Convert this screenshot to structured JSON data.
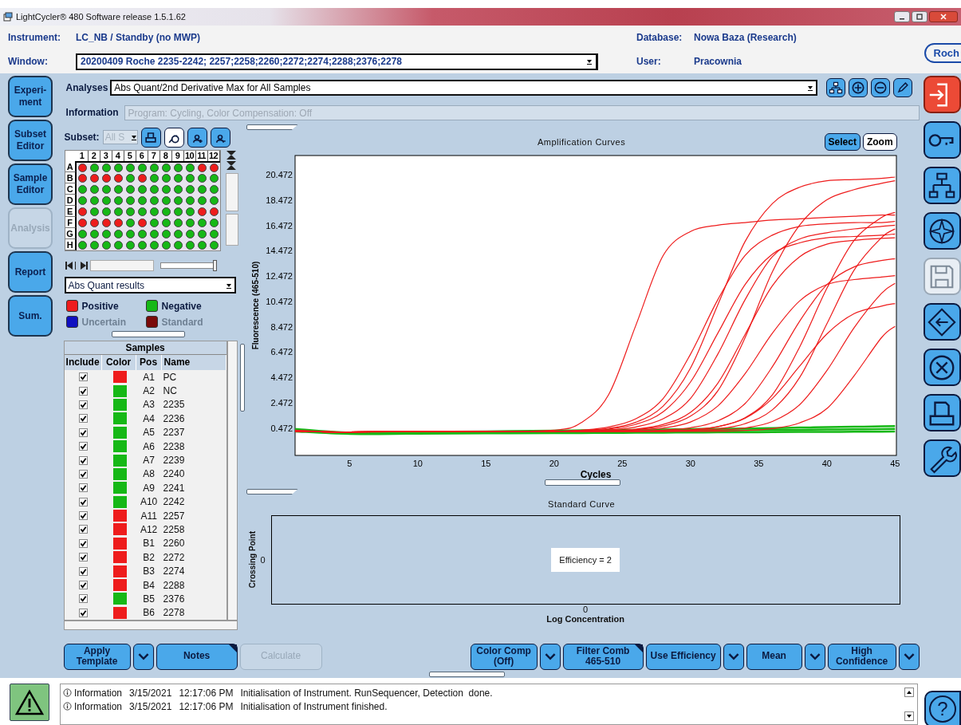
{
  "window": {
    "title": "LightCycler® 480 Software release 1.5.1.62"
  },
  "header": {
    "instrument_label": "Instrument:",
    "instrument": "LC_NB / Standby (no MWP)",
    "database_label": "Database:",
    "database": "Nowa Baza (Research)",
    "window_label": "Window:",
    "window_value": "20200409 Roche 2235-2242; 2257;2258;2260;2272;2274;2288;2376;2278",
    "user_label": "User:",
    "user": "Pracownia",
    "logo": "Roch"
  },
  "nav": [
    {
      "label": "Experi-\nment",
      "disabled": false
    },
    {
      "label": "Subset\nEditor",
      "disabled": false
    },
    {
      "label": "Sample\nEditor",
      "disabled": false
    },
    {
      "label": "Analysis",
      "disabled": true
    },
    {
      "label": "Report",
      "disabled": false
    },
    {
      "label": "Sum.",
      "disabled": false
    }
  ],
  "analyses": {
    "label": "Analyses",
    "value": "Abs Quant/2nd Derivative Max for All Samples",
    "information": {
      "label": "Information",
      "value": "Program: Cycling, Color Compensation: Off",
      "disabled": true
    }
  },
  "subset": {
    "label": "Subset:",
    "value": "All S",
    "disabled": true
  },
  "plate": {
    "columns": [
      "1",
      "2",
      "3",
      "4",
      "5",
      "6",
      "7",
      "8",
      "9",
      "10",
      "11",
      "12"
    ],
    "rows": [
      {
        "label": "A",
        "wells": [
          {
            "color": "#ee1c1c"
          },
          {
            "color": "#16b816"
          },
          {
            "color": "#16b816"
          },
          {
            "color": "#16b816"
          },
          {
            "color": "#16b816"
          },
          {
            "color": "#16b816"
          },
          {
            "color": "#16b816"
          },
          {
            "color": "#16b816"
          },
          {
            "color": "#16b816"
          },
          {
            "color": "#16b816"
          },
          {
            "color": "#ee1c1c"
          },
          {
            "color": "#ee1c1c"
          }
        ]
      },
      {
        "label": "B",
        "wells": [
          {
            "color": "#ee1c1c"
          },
          {
            "color": "#ee1c1c"
          },
          {
            "color": "#ee1c1c"
          },
          {
            "color": "#ee1c1c"
          },
          {
            "color": "#16b816"
          },
          {
            "color": "#ee1c1c"
          },
          {
            "color": "#16b816"
          },
          {
            "color": "#16b816"
          },
          {
            "color": "#16b816"
          },
          {
            "color": "#16b816"
          },
          {
            "color": "#16b816"
          },
          {
            "color": "#16b816"
          }
        ]
      },
      {
        "label": "C",
        "wells": [
          {
            "color": "#16b816"
          },
          {
            "color": "#16b816"
          },
          {
            "color": "#16b816"
          },
          {
            "color": "#16b816"
          },
          {
            "color": "#16b816"
          },
          {
            "color": "#16b816"
          },
          {
            "color": "#16b816"
          },
          {
            "color": "#16b816"
          },
          {
            "color": "#16b816"
          },
          {
            "color": "#16b816"
          },
          {
            "color": "#16b816"
          },
          {
            "color": "#16b816"
          }
        ]
      },
      {
        "label": "D",
        "wells": [
          {
            "color": "#16b816"
          },
          {
            "color": "#16b816"
          },
          {
            "color": "#16b816"
          },
          {
            "color": "#16b816"
          },
          {
            "color": "#16b816"
          },
          {
            "color": "#16b816"
          },
          {
            "color": "#16b816"
          },
          {
            "color": "#16b816"
          },
          {
            "color": "#16b816"
          },
          {
            "color": "#16b816"
          },
          {
            "color": "#16b816"
          },
          {
            "color": "#16b816"
          }
        ]
      },
      {
        "label": "E",
        "wells": [
          {
            "color": "#ee1c1c"
          },
          {
            "color": "#16b816"
          },
          {
            "color": "#16b816"
          },
          {
            "color": "#16b816"
          },
          {
            "color": "#16b816"
          },
          {
            "color": "#16b816"
          },
          {
            "color": "#16b816"
          },
          {
            "color": "#16b816"
          },
          {
            "color": "#16b816"
          },
          {
            "color": "#16b816"
          },
          {
            "color": "#ee1c1c"
          },
          {
            "color": "#ee1c1c"
          }
        ]
      },
      {
        "label": "F",
        "wells": [
          {
            "color": "#ee1c1c"
          },
          {
            "color": "#ee1c1c"
          },
          {
            "color": "#ee1c1c"
          },
          {
            "color": "#ee1c1c"
          },
          {
            "color": "#16b816"
          },
          {
            "color": "#ee1c1c"
          },
          {
            "color": "#16b816"
          },
          {
            "color": "#16b816"
          },
          {
            "color": "#16b816"
          },
          {
            "color": "#16b816"
          },
          {
            "color": "#16b816"
          },
          {
            "color": "#16b816"
          }
        ]
      },
      {
        "label": "G",
        "wells": [
          {
            "color": "#16b816"
          },
          {
            "color": "#16b816"
          },
          {
            "color": "#16b816"
          },
          {
            "color": "#16b816"
          },
          {
            "color": "#16b816"
          },
          {
            "color": "#16b816"
          },
          {
            "color": "#16b816"
          },
          {
            "color": "#16b816"
          },
          {
            "color": "#16b816"
          },
          {
            "color": "#16b816"
          },
          {
            "color": "#16b816"
          },
          {
            "color": "#16b816"
          }
        ]
      },
      {
        "label": "H",
        "wells": [
          {
            "color": "#16b816"
          },
          {
            "color": "#16b816"
          },
          {
            "color": "#16b816"
          },
          {
            "color": "#16b816"
          },
          {
            "color": "#16b816"
          },
          {
            "color": "#16b816"
          },
          {
            "color": "#16b816"
          },
          {
            "color": "#16b816"
          },
          {
            "color": "#16b816"
          },
          {
            "color": "#16b816"
          },
          {
            "color": "#16b816"
          },
          {
            "color": "#16b816"
          }
        ]
      }
    ]
  },
  "zoom_slider": {
    "level": 1
  },
  "report_select": "Abs Quant results",
  "legend": [
    {
      "label": "Positive",
      "color": "#ee1c1c",
      "disabled": false
    },
    {
      "label": "Negative",
      "color": "#16b816",
      "disabled": false
    },
    {
      "label": "Uncertain",
      "color": "#1010c0",
      "disabled": true
    },
    {
      "label": "Standard",
      "color": "#7a0a0a",
      "disabled": true
    }
  ],
  "samples": {
    "title": "Samples",
    "columns": [
      "Include",
      "Color",
      "Pos",
      "Name"
    ],
    "rows": [
      {
        "checked": true,
        "color": "#ee1c1c",
        "pos": "A1",
        "name": "PC"
      },
      {
        "checked": true,
        "color": "#16b816",
        "pos": "A2",
        "name": "NC"
      },
      {
        "checked": true,
        "color": "#16b816",
        "pos": "A3",
        "name": "2235"
      },
      {
        "checked": true,
        "color": "#16b816",
        "pos": "A4",
        "name": "2236"
      },
      {
        "checked": true,
        "color": "#16b816",
        "pos": "A5",
        "name": "2237"
      },
      {
        "checked": true,
        "color": "#16b816",
        "pos": "A6",
        "name": "2238"
      },
      {
        "checked": true,
        "color": "#16b816",
        "pos": "A7",
        "name": "2239"
      },
      {
        "checked": true,
        "color": "#16b816",
        "pos": "A8",
        "name": "2240"
      },
      {
        "checked": true,
        "color": "#16b816",
        "pos": "A9",
        "name": "2241"
      },
      {
        "checked": true,
        "color": "#16b816",
        "pos": "A10",
        "name": "2242"
      },
      {
        "checked": true,
        "color": "#ee1c1c",
        "pos": "A11",
        "name": "2257"
      },
      {
        "checked": true,
        "color": "#ee1c1c",
        "pos": "A12",
        "name": "2258"
      },
      {
        "checked": true,
        "color": "#ee1c1c",
        "pos": "B1",
        "name": "2260"
      },
      {
        "checked": true,
        "color": "#ee1c1c",
        "pos": "B2",
        "name": "2272"
      },
      {
        "checked": true,
        "color": "#ee1c1c",
        "pos": "B3",
        "name": "2274"
      },
      {
        "checked": true,
        "color": "#ee1c1c",
        "pos": "B4",
        "name": "2288"
      },
      {
        "checked": true,
        "color": "#16b816",
        "pos": "B5",
        "name": "2376"
      },
      {
        "checked": true,
        "color": "#ee1c1c",
        "pos": "B6",
        "name": "2278"
      }
    ]
  },
  "amplification": {
    "tabs": [
      {
        "label": "Select",
        "selected": true
      },
      {
        "label": "Zoom",
        "selected": false
      }
    ],
    "chart_data": {
      "type": "line",
      "title": "Amplification Curves",
      "xlabel": "Cycles",
      "ylabel": "Fluorescence (465-510)",
      "x": [
        1,
        5,
        10,
        15,
        20,
        22,
        24,
        26,
        28,
        30,
        32,
        34,
        36,
        38,
        40,
        42,
        44,
        45
      ],
      "xlim": [
        1,
        45.1
      ],
      "ylim": [
        -1.7,
        22
      ],
      "xticks": [
        5,
        10,
        15,
        20,
        25,
        30,
        35,
        40,
        45
      ],
      "yticks": [
        0.472,
        2.472,
        4.472,
        6.472,
        8.472,
        10.472,
        12.472,
        14.472,
        16.472,
        18.472,
        20.472
      ],
      "series": [
        {
          "color": "#16b816",
          "values": [
            0.4,
            0.1,
            0.15,
            0.2,
            0.25,
            0.28,
            0.3,
            0.32,
            0.35,
            0.38,
            0.4,
            0.43,
            0.46,
            0.5,
            0.53,
            0.56,
            0.6,
            0.62
          ]
        },
        {
          "color": "#16b816",
          "values": [
            0.3,
            0.05,
            0.1,
            0.12,
            0.15,
            0.17,
            0.18,
            0.2,
            0.22,
            0.24,
            0.26,
            0.28,
            0.3,
            0.32,
            0.34,
            0.36,
            0.38,
            0.4
          ]
        },
        {
          "color": "#16b816",
          "values": [
            0.2,
            0.0,
            0.02,
            0.05,
            0.06,
            0.07,
            0.08,
            0.09,
            0.1,
            0.11,
            0.12,
            0.13,
            0.14,
            0.15,
            0.16,
            0.17,
            0.18,
            0.19
          ]
        },
        {
          "color": "#ee1c1c",
          "values": [
            0.3,
            0.15,
            0.2,
            0.2,
            0.3,
            0.9,
            3.1,
            8.6,
            14.1,
            16.0,
            16.5,
            16.7,
            16.9,
            17.0,
            17.1,
            17.2,
            17.3,
            17.3
          ]
        },
        {
          "color": "#ee1c1c",
          "values": [
            0.2,
            0.15,
            0.2,
            0.2,
            0.2,
            0.28,
            0.44,
            0.92,
            2.2,
            5.2,
            10.2,
            15.2,
            18.2,
            19.5,
            20.0,
            20.1,
            20.2,
            20.3
          ]
        },
        {
          "color": "#ee1c1c",
          "values": [
            0.2,
            0.15,
            0.2,
            0.2,
            0.2,
            0.2,
            0.25,
            0.34,
            0.62,
            1.4,
            3.4,
            7.6,
            12.8,
            16.5,
            18.5,
            19.3,
            19.8,
            20.0
          ]
        },
        {
          "color": "#ee1c1c",
          "values": [
            0.2,
            0.15,
            0.2,
            0.2,
            0.2,
            0.3,
            0.55,
            1.2,
            2.8,
            6.3,
            10.6,
            14.1,
            15.7,
            16.4,
            16.6,
            16.7,
            16.7,
            16.8
          ]
        },
        {
          "color": "#ee1c1c",
          "values": [
            0.2,
            0.15,
            0.2,
            0.2,
            0.2,
            0.26,
            0.39,
            0.76,
            1.75,
            4.1,
            7.95,
            11.8,
            14.2,
            15.1,
            15.5,
            15.6,
            15.7,
            15.8
          ]
        },
        {
          "color": "#ee1c1c",
          "values": [
            0.25,
            0.15,
            0.2,
            0.2,
            0.2,
            0.23,
            0.32,
            0.55,
            1.2,
            2.8,
            6.3,
            10.6,
            14.0,
            15.4,
            15.9,
            16.2,
            16.4,
            16.5
          ]
        },
        {
          "color": "#ee1c1c",
          "values": [
            0.2,
            0.15,
            0.2,
            0.2,
            0.2,
            0.2,
            0.26,
            0.38,
            0.75,
            1.7,
            4.0,
            7.85,
            11.7,
            14.0,
            15.0,
            15.3,
            15.45,
            15.5
          ]
        },
        {
          "color": "#ee1c1c",
          "values": [
            0.2,
            0.15,
            0.2,
            0.2,
            0.2,
            0.2,
            0.24,
            0.29,
            0.46,
            0.94,
            2.2,
            4.75,
            7.95,
            10.5,
            11.8,
            12.2,
            12.4,
            12.5
          ]
        },
        {
          "color": "#ee1c1c",
          "values": [
            0.2,
            0.15,
            0.2,
            0.2,
            0.2,
            0.2,
            0.2,
            0.23,
            0.3,
            0.49,
            1.03,
            2.4,
            5.3,
            8.9,
            11.8,
            13.2,
            13.7,
            13.85
          ]
        },
        {
          "color": "#ee1c1c",
          "values": [
            0.2,
            0.15,
            0.2,
            0.2,
            0.2,
            0.2,
            0.2,
            0.2,
            0.24,
            0.33,
            0.58,
            1.28,
            3.08,
            6.86,
            11.5,
            15.3,
            17.1,
            17.5
          ]
        },
        {
          "color": "#ee1c1c",
          "values": [
            0.2,
            0.15,
            0.2,
            0.2,
            0.2,
            0.2,
            0.2,
            0.2,
            0.2,
            0.27,
            0.4,
            0.81,
            1.9,
            4.45,
            8.7,
            12.95,
            15.5,
            16.2
          ]
        },
        {
          "color": "#ee1c1c",
          "values": [
            0.2,
            0.15,
            0.2,
            0.2,
            0.2,
            0.2,
            0.2,
            0.2,
            0.24,
            0.32,
            0.57,
            1.23,
            2.8,
            5.35,
            7.9,
            9.5,
            10.1,
            10.3
          ]
        },
        {
          "color": "#ee1c1c",
          "values": [
            0.2,
            0.15,
            0.2,
            0.2,
            0.2,
            0.2,
            0.2,
            0.2,
            0.2,
            0.23,
            0.29,
            0.47,
            0.98,
            2.3,
            5.0,
            8.4,
            11.1,
            11.9
          ]
        },
        {
          "color": "#ee1c1c",
          "values": [
            0.2,
            0.15,
            0.2,
            0.2,
            0.2,
            0.2,
            0.2,
            0.2,
            0.2,
            0.2,
            0.2,
            0.27,
            0.42,
            0.87,
            2.0,
            4.6,
            7.6,
            8.5
          ]
        }
      ]
    }
  },
  "standard_curve": {
    "title": "Standard Curve",
    "ylabel": "Crossing Point",
    "ytick": "0",
    "xtick": "0",
    "xlabel": "Log Concentration",
    "efficiency": "Efficiency = 2"
  },
  "buttons_left": [
    {
      "label": "Apply\nTemplate",
      "dropdown": true,
      "marked": false,
      "disabled": false
    },
    {
      "label": "Notes",
      "dropdown": false,
      "marked": true,
      "disabled": false
    },
    {
      "label": "Calculate",
      "dropdown": false,
      "marked": false,
      "disabled": true
    }
  ],
  "buttons_right": [
    {
      "label": "Color Comp\n(Off)",
      "dropdown": true,
      "marked": false,
      "disabled": false
    },
    {
      "label": "Filter Comb\n465-510",
      "dropdown": false,
      "marked": true,
      "disabled": false
    },
    {
      "label": "Use Efficiency",
      "dropdown": true,
      "marked": false,
      "disabled": false
    },
    {
      "label": "Mean",
      "dropdown": true,
      "marked": false,
      "disabled": false
    },
    {
      "label": "High\nConfidence",
      "dropdown": true,
      "marked": false,
      "disabled": false
    }
  ],
  "messages": [
    {
      "level": "Information",
      "date": "3/15/2021",
      "time": "12:17:06 PM",
      "text": "Initialisation of Instrument. RunSequencer, Detection  done."
    },
    {
      "level": "Information",
      "date": "3/15/2021",
      "time": "12:17:06 PM",
      "text": "Initialisation of Instrument finished."
    }
  ],
  "sidebar": [
    {
      "kind": "exit",
      "disabled": false
    },
    {
      "kind": "key",
      "disabled": false
    },
    {
      "kind": "tree",
      "disabled": false
    },
    {
      "kind": "compass",
      "disabled": false
    },
    {
      "kind": "save",
      "disabled": true
    },
    {
      "kind": "navigate",
      "disabled": false
    },
    {
      "kind": "cancel",
      "disabled": false
    },
    {
      "kind": "print",
      "disabled": false
    },
    {
      "kind": "tools",
      "disabled": false
    }
  ],
  "help": "?"
}
